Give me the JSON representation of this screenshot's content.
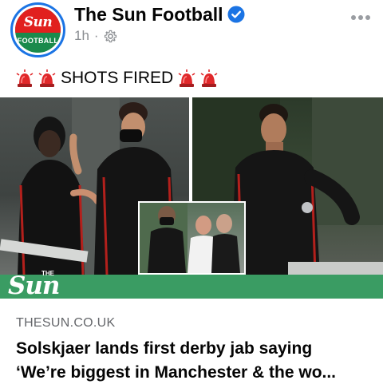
{
  "header": {
    "page_name": "The Sun Football",
    "timestamp": "1h",
    "separator": "·",
    "avatar_logo_word": "Sun",
    "avatar_logo_sub": "FOOTBALL",
    "verified_color": "#1b74e4"
  },
  "post": {
    "text": "SHOTS FIRED",
    "emoji_icon": "police-siren-icon"
  },
  "media": {
    "banner_logo_word": "Sun",
    "banner_logo_prefix": "THE",
    "banner_color": "#3a9c63"
  },
  "link_preview": {
    "domain": "THESUN.CO.UK",
    "title_line1": "Solskjaer lands first derby jab saying",
    "title_line2": "‘We’re biggest in Manchester & the wo..."
  }
}
